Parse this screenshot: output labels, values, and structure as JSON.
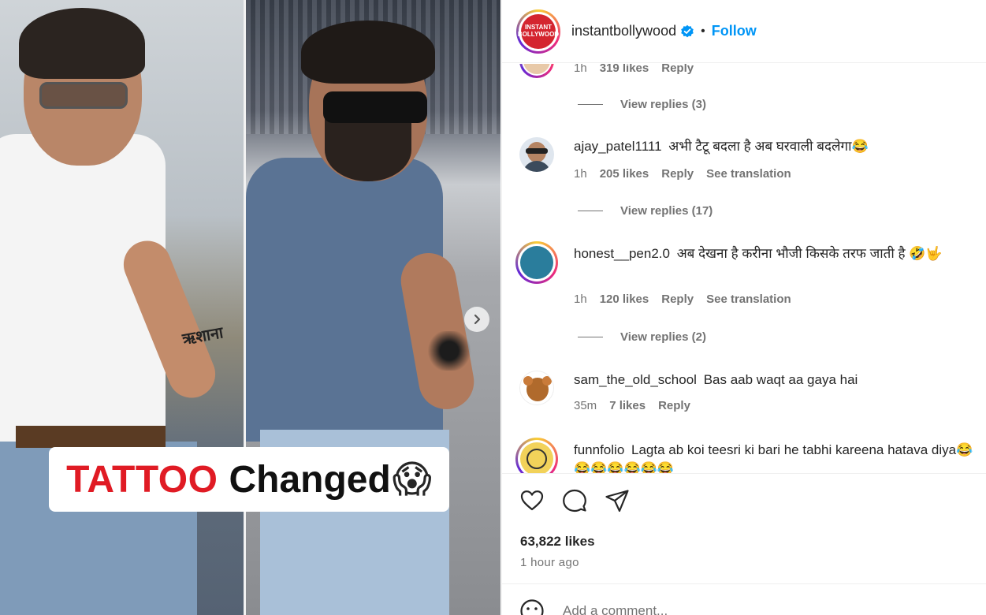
{
  "media": {
    "caption_red": "TATTOO",
    "caption_black": "Changed",
    "caption_emoji": "😱",
    "tattoo_text": "ऋशाना"
  },
  "header": {
    "username": "instantbollywood",
    "separator": "•",
    "follow_label": "Follow",
    "logo_text": "INSTANT BOLLYWOOD"
  },
  "comments": {
    "partial": {
      "time": "1h",
      "likes": "319 likes",
      "reply": "Reply",
      "view_replies": "View replies (3)"
    },
    "items": [
      {
        "user": "ajay_patel1111",
        "text": "अभी टैटू बदला है अब घरवाली बदलेगा😂",
        "time": "1h",
        "likes": "205 likes",
        "reply": "Reply",
        "translate": "See translation",
        "view_replies": "View replies (17)"
      },
      {
        "user": "honest__pen2.0",
        "text": "अब देखना है करीना भौजी किसके तरफ जाती है 🤣🤟",
        "time": "1h",
        "likes": "120 likes",
        "reply": "Reply",
        "translate": "See translation",
        "view_replies": "View replies (2)"
      },
      {
        "user": "sam_the_old_school",
        "text": "Bas aab waqt aa gaya hai",
        "time": "35m",
        "likes": "7 likes",
        "reply": "Reply"
      },
      {
        "user": "funnfolio",
        "text": "Lagta ab koi teesri ki bari he tabhi kareena hatava diya😂😂😂😂😂😂😂"
      }
    ]
  },
  "footer": {
    "likes": "63,822 likes",
    "time": "1 hour ago",
    "add_comment_placeholder": "Add a comment..."
  },
  "colors": {
    "accent": "#0095f6",
    "caption_red": "#e01b24",
    "muted": "#737373"
  }
}
